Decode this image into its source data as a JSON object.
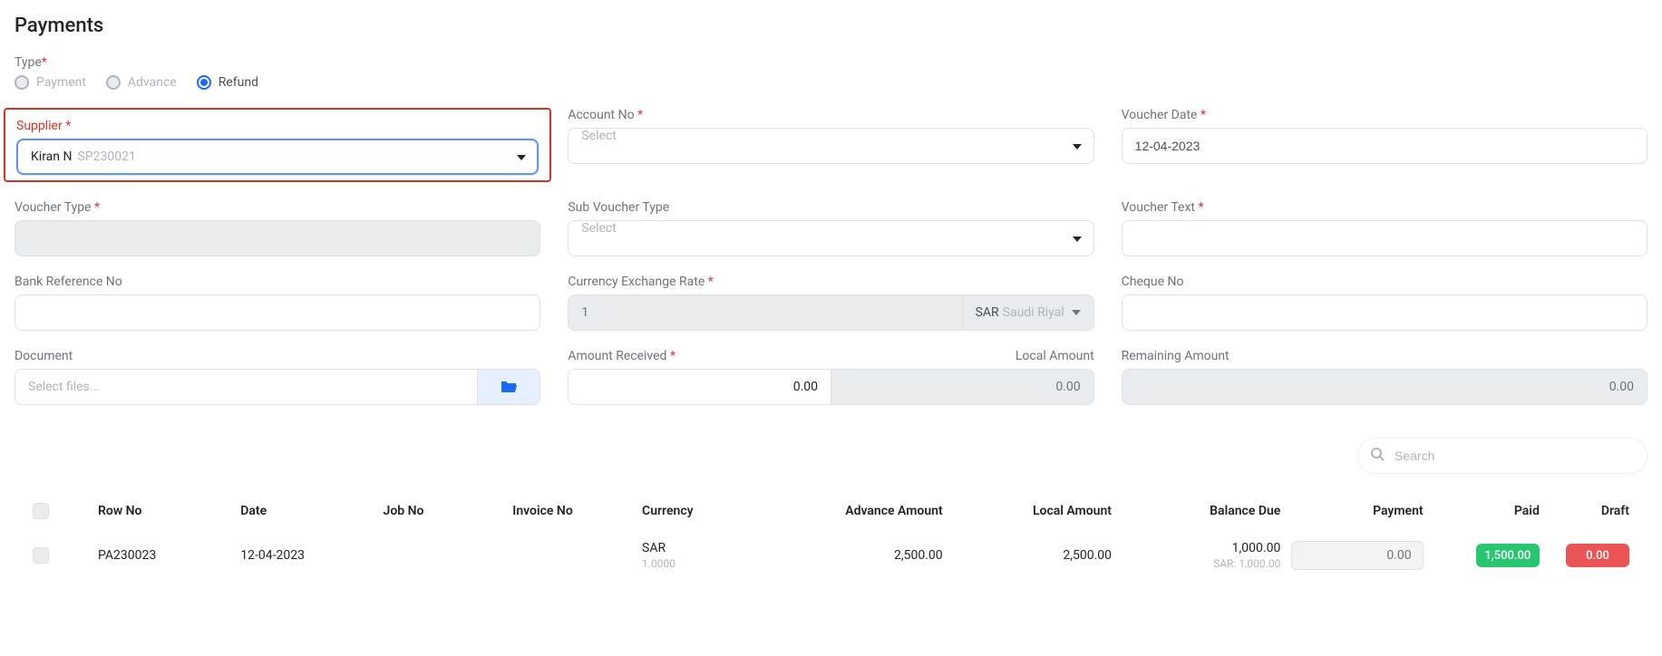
{
  "page": {
    "title": "Payments"
  },
  "type": {
    "label": "Type",
    "options": {
      "payment": "Payment",
      "advance": "Advance",
      "refund": "Refund"
    },
    "selected": "refund"
  },
  "fields": {
    "supplier": {
      "label": "Supplier",
      "name": "Kiran N",
      "code": "SP230021"
    },
    "accountNo": {
      "label": "Account No",
      "placeholder": "Select"
    },
    "voucherDate": {
      "label": "Voucher Date",
      "value": "12-04-2023"
    },
    "voucherType": {
      "label": "Voucher Type",
      "value": ""
    },
    "subVoucherType": {
      "label": "Sub Voucher Type",
      "placeholder": "Select"
    },
    "voucherText": {
      "label": "Voucher Text",
      "value": ""
    },
    "bankRef": {
      "label": "Bank Reference No",
      "value": ""
    },
    "exchangeRate": {
      "label": "Currency Exchange Rate",
      "value": "1",
      "ccyCode": "SAR",
      "ccyName": "Saudi Riyal"
    },
    "chequeNo": {
      "label": "Cheque No",
      "value": ""
    },
    "document": {
      "label": "Document",
      "placeholder": "Select files..."
    },
    "amountReceived": {
      "label": "Amount Received",
      "localLabel": "Local Amount",
      "value": "0.00",
      "local": "0.00"
    },
    "remaining": {
      "label": "Remaining Amount",
      "value": "0.00"
    }
  },
  "search": {
    "placeholder": "Search"
  },
  "table": {
    "headers": {
      "rowNo": "Row No",
      "date": "Date",
      "jobNo": "Job No",
      "invoiceNo": "Invoice No",
      "currency": "Currency",
      "advanceAmount": "Advance Amount",
      "localAmount": "Local Amount",
      "balanceDue": "Balance Due",
      "payment": "Payment",
      "paid": "Paid",
      "draft": "Draft"
    },
    "rows": [
      {
        "rowNo": "PA230023",
        "date": "12-04-2023",
        "jobNo": "",
        "invoiceNo": "",
        "currency": "SAR",
        "rate": "1.0000",
        "advanceAmount": "2,500.00",
        "localAmount": "2,500.00",
        "balanceDue": "1,000.00",
        "balanceDueSub": "SAR: 1,000.00",
        "payment": "0.00",
        "paid": "1,500.00",
        "draft": "0.00"
      }
    ]
  }
}
